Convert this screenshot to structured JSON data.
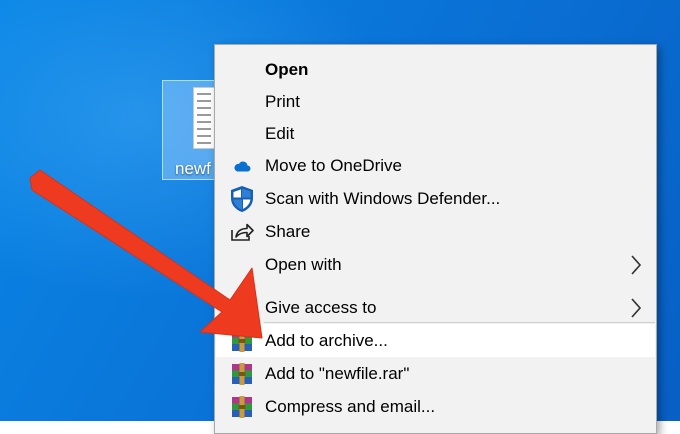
{
  "desktop": {
    "file_label": "newf"
  },
  "menu": {
    "items": [
      {
        "label": "Open",
        "icon": "none"
      },
      {
        "label": "Print",
        "icon": "none"
      },
      {
        "label": "Edit",
        "icon": "none"
      },
      {
        "label": "Move to OneDrive",
        "icon": "onedrive-cloud-icon"
      },
      {
        "label": "Scan with Windows Defender...",
        "icon": "windows-defender-shield-icon"
      },
      {
        "label": "Share",
        "icon": "share-icon"
      },
      {
        "label": "Open with",
        "icon": "none"
      },
      {
        "label": "Give access to",
        "icon": "none"
      },
      {
        "label": "Add to archive...",
        "icon": "winrar-icon"
      },
      {
        "label": "Add to \"newfile.rar\"",
        "icon": "winrar-icon"
      },
      {
        "label": "Compress and email...",
        "icon": "winrar-icon"
      }
    ]
  },
  "colors": {
    "desktop_blue": "#0a74d8",
    "menu_background": "#f2f2f2",
    "hover_background": "#ffffff",
    "annotation_arrow": "#ee3b1f",
    "onedrive_blue": "#0a6fd1",
    "defender_blue": "#1660b4"
  }
}
